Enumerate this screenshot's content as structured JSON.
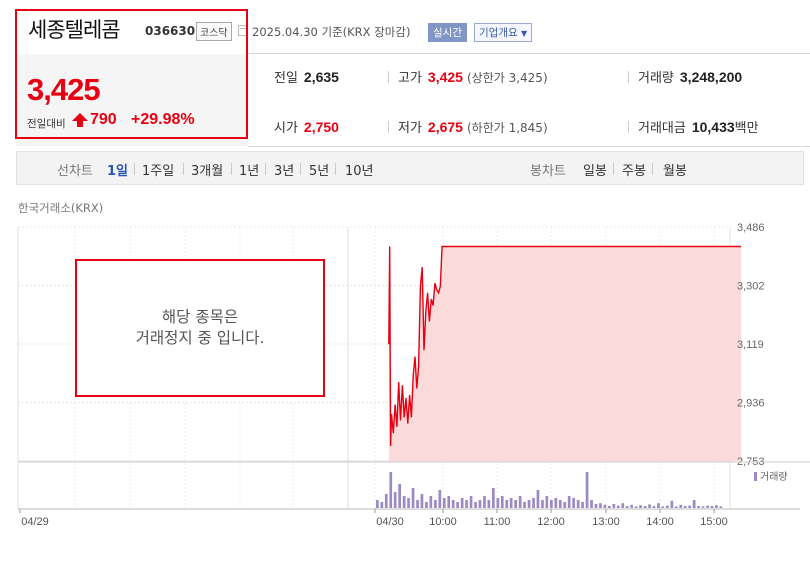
{
  "header": {
    "company": "세종텔레콤",
    "code": "036630",
    "market_badge": "코스닥",
    "date_text": "2025.04.30 기준(KRX 장마감)",
    "realtime_label": "실시간",
    "company_info_button": "기업개요"
  },
  "price": {
    "current": "3,425",
    "change_label": "전일대비",
    "change": "790",
    "change_rate": "+29.98%"
  },
  "stats": {
    "prev_close_label": "전일",
    "prev_close": "2,635",
    "high_label": "고가",
    "high": "3,425",
    "upper_limit": "(상한가 3,425)",
    "volume_label": "거래량",
    "volume": "3,248,200",
    "open_label": "시가",
    "open": "2,750",
    "low_label": "저가",
    "low": "2,675",
    "lower_limit": "(하한가 1,845)",
    "amount_label": "거래대금",
    "amount": "10,433",
    "amount_unit": "백만"
  },
  "tabs": {
    "line_chart": "선차트",
    "d1": "1일",
    "w1": "1주일",
    "m3": "3개월",
    "y1": "1년",
    "y3": "3년",
    "y5": "5년",
    "y10": "10년",
    "candle_chart": "봉차트",
    "daily": "일봉",
    "weekly": "주봉",
    "monthly": "월봉"
  },
  "exchange_label": "한국거래소(KRX)",
  "notice": {
    "line1": "해당 종목은",
    "line2": "거래정지 중 입니다."
  },
  "volume_legend": "거래량",
  "colors": {
    "up": "#e60012",
    "fill": "#fbdada",
    "volume": "#9b8ac4",
    "link": "#2854b8"
  },
  "chart_data": {
    "type": "area",
    "y_ticks": [
      "3,486",
      "3,302",
      "3,119",
      "2,936",
      "2,753"
    ],
    "ylim": [
      2753,
      3486
    ],
    "x_ticks": [
      "04/29",
      "04/30",
      "10:00",
      "11:00",
      "12:00",
      "13:00",
      "14:00",
      "15:00"
    ],
    "series": [
      {
        "x": [
          "09:00",
          "09:01",
          "09:02",
          "09:03",
          "09:05",
          "09:07",
          "09:09",
          "09:11",
          "09:13",
          "09:15",
          "09:17",
          "09:19",
          "09:21",
          "09:23",
          "09:25",
          "09:27",
          "09:29",
          "09:31",
          "09:33",
          "09:35",
          "09:37",
          "09:39",
          "09:41",
          "09:43",
          "09:45",
          "09:47",
          "09:49",
          "09:51",
          "09:53",
          "09:55",
          "09:57",
          "09:59",
          "10:01",
          "10:03",
          "15:30"
        ],
        "values": [
          3119,
          3425,
          2800,
          2900,
          2840,
          2930,
          2860,
          3000,
          2880,
          2990,
          2890,
          2950,
          2870,
          2960,
          2890,
          3020,
          3080,
          2980,
          3050,
          3300,
          3360,
          3100,
          3220,
          3280,
          3190,
          3260,
          3240,
          3310,
          3290,
          3280,
          3300,
          3425,
          3425,
          3425,
          3425
        ]
      }
    ],
    "volume_heights": [
      0.2,
      0.15,
      0.35,
      0.9,
      0.4,
      0.6,
      0.3,
      0.25,
      0.5,
      0.2,
      0.35,
      0.15,
      0.3,
      0.2,
      0.45,
      0.25,
      0.3,
      0.2,
      0.15,
      0.25,
      0.2,
      0.3,
      0.15,
      0.2,
      0.3,
      0.2,
      0.5,
      0.25,
      0.3,
      0.2,
      0.25,
      0.2,
      0.3,
      0.15,
      0.2,
      0.25,
      0.45,
      0.2,
      0.3,
      0.2,
      0.25,
      0.2,
      0.15,
      0.3,
      0.25,
      0.2,
      0.15,
      0.9,
      0.2,
      0.1,
      0.12,
      0.08,
      0.05,
      0.1,
      0.06,
      0.12,
      0.05,
      0.08,
      0.04,
      0.07,
      0.05,
      0.09,
      0.05,
      0.12,
      0.04,
      0.06,
      0.18,
      0.04,
      0.08,
      0.05,
      0.06,
      0.2,
      0.05,
      0.04,
      0.06,
      0.05,
      0.07,
      0.04
    ],
    "grid": true,
    "legend_position": "right"
  }
}
